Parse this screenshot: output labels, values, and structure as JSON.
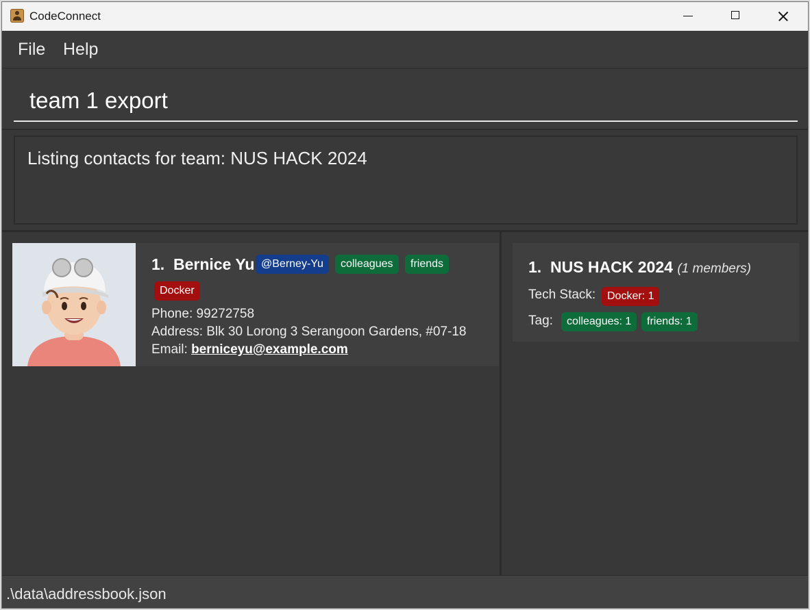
{
  "window": {
    "title": "CodeConnect",
    "app_icon": "contact-card-icon",
    "controls": [
      "minimize-icon",
      "maximize-icon",
      "close-icon"
    ]
  },
  "menu": {
    "items": [
      {
        "label": "File"
      },
      {
        "label": "Help"
      }
    ]
  },
  "command": {
    "value": "team 1 export"
  },
  "result": {
    "message": "Listing contacts for team: NUS HACK 2024"
  },
  "persons": [
    {
      "index": "1.",
      "name": "Bernice Yu",
      "github": "@Berney-Yu",
      "tags": [
        "colleagues",
        "friends"
      ],
      "tech_stack": [
        "Docker"
      ],
      "phone": "Phone: 99272758",
      "address": "Address: Blk 30 Lorong 3 Serangoon Gardens, #07-18",
      "email_label": "Email: ",
      "email": "berniceyu@example.com"
    }
  ],
  "teams": [
    {
      "index": "1.",
      "name": "NUS HACK 2024",
      "members": "(1 members)",
      "tech_stack_label": "Tech Stack:",
      "tech_stack": [
        "Docker: 1"
      ],
      "tag_label": "Tag:",
      "tags": [
        "colleagues: 1",
        "friends: 1"
      ]
    }
  ],
  "status": {
    "file_path": ".\\data\\addressbook.json"
  },
  "colors": {
    "background": "#383838",
    "github_badge": "#143d8c",
    "tag_badge": "#0e6b3a",
    "tech_badge": "#a30f0f"
  }
}
